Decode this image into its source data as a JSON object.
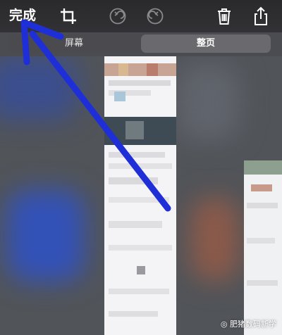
{
  "toolbar": {
    "done_label": "完成",
    "icons": [
      "crop-icon",
      "undo-icon",
      "redo-icon",
      "trash-icon",
      "share-icon"
    ]
  },
  "segmented": {
    "options": [
      "屏幕",
      "整页"
    ],
    "selected": "整页"
  },
  "watermark": {
    "text": "肥猪数码新学"
  },
  "colors": {
    "toolbar_bg": "#2c2c2e",
    "segment_selected": "#6a6a6e",
    "arrow": "#1f2fd8"
  }
}
